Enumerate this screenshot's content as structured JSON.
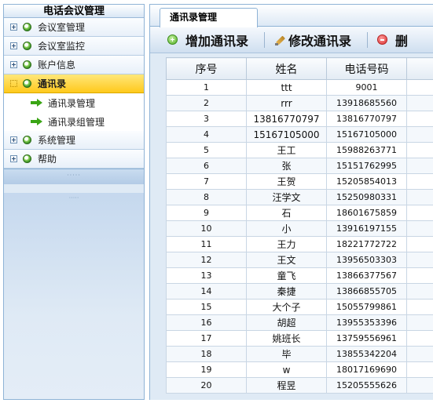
{
  "sidebar": {
    "title": "电话会议管理",
    "items": [
      {
        "label": "会议室管理"
      },
      {
        "label": "会议室监控"
      },
      {
        "label": "账户信息"
      },
      {
        "label": "通讯录"
      },
      {
        "label": "系统管理"
      },
      {
        "label": "帮助"
      }
    ],
    "subitems": [
      {
        "label": "通讯录管理"
      },
      {
        "label": "通讯录组管理"
      }
    ]
  },
  "tab": {
    "label": "通讯录管理"
  },
  "toolbar": {
    "add_label": "增加通讯录",
    "edit_label": "修改通讯录",
    "delete_label": "删"
  },
  "table": {
    "headers": [
      "序号",
      "姓名",
      "电话号码",
      ""
    ],
    "rows": [
      [
        "1",
        "ttt",
        "9001"
      ],
      [
        "2",
        "rrr",
        "13918685560"
      ],
      [
        "3",
        "13816770797",
        "13816770797"
      ],
      [
        "4",
        "15167105000",
        "15167105000"
      ],
      [
        "5",
        "王工",
        "15988263771"
      ],
      [
        "6",
        "张",
        "15151762995"
      ],
      [
        "7",
        "王贺",
        "15205854013"
      ],
      [
        "8",
        "汪学文",
        "15250980331"
      ],
      [
        "9",
        "石",
        "18601675859"
      ],
      [
        "10",
        "小",
        "13916197155"
      ],
      [
        "11",
        "王力",
        "18221772722"
      ],
      [
        "12",
        "王文",
        "13956503303"
      ],
      [
        "13",
        "童飞",
        "13866377567"
      ],
      [
        "14",
        "秦捷",
        "13866855705"
      ],
      [
        "15",
        "大个子",
        "15055799861"
      ],
      [
        "16",
        "胡超",
        "13955353396"
      ],
      [
        "17",
        "姚班长",
        "13759556961"
      ],
      [
        "18",
        "毕",
        "13855342204"
      ],
      [
        "19",
        "w",
        "18017169690"
      ],
      [
        "20",
        "程昱",
        "15205555626"
      ]
    ]
  }
}
